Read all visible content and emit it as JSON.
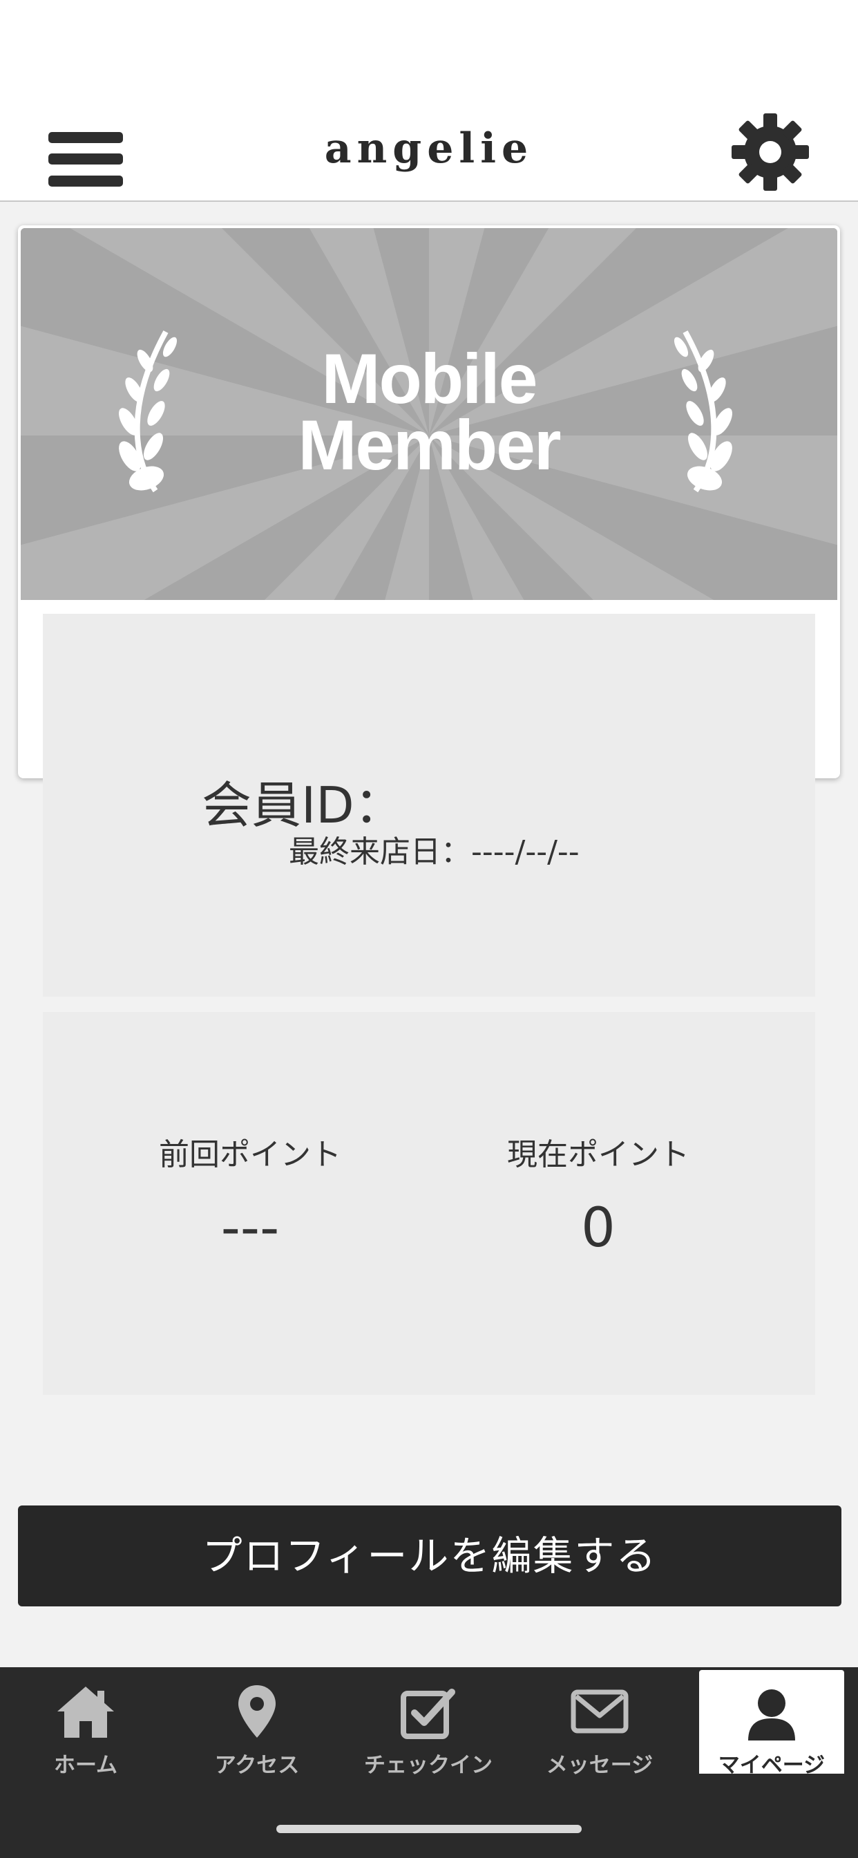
{
  "header": {
    "logo_text": "angelie",
    "menu_icon": "hamburger-menu-icon",
    "settings_icon": "gear-icon"
  },
  "banner": {
    "title_line1": "Mobile",
    "title_line2": "Member",
    "decoration_icon": "laurel-branch-icon",
    "background_color": "#a8a8a8"
  },
  "member": {
    "id_label": "会員ID：",
    "last_visit": "最終来店日：----/--/--"
  },
  "points": {
    "previous_label": "前回ポイント",
    "previous_value": "---",
    "current_label": "現在ポイント",
    "current_value": "0"
  },
  "edit_profile_label": "プロフィールを編集する",
  "tabs": [
    {
      "label": "ホーム",
      "icon": "home-icon",
      "active": false
    },
    {
      "label": "アクセス",
      "icon": "map-pin-icon",
      "active": false
    },
    {
      "label": "チェックイン",
      "icon": "checkbox-icon",
      "active": false
    },
    {
      "label": "メッセージ",
      "icon": "envelope-icon",
      "active": false
    },
    {
      "label": "マイページ",
      "icon": "user-icon",
      "active": true
    }
  ],
  "colors": {
    "dark": "#272727",
    "panel": "#ececec",
    "tab_inactive": "#bdbdbd"
  }
}
